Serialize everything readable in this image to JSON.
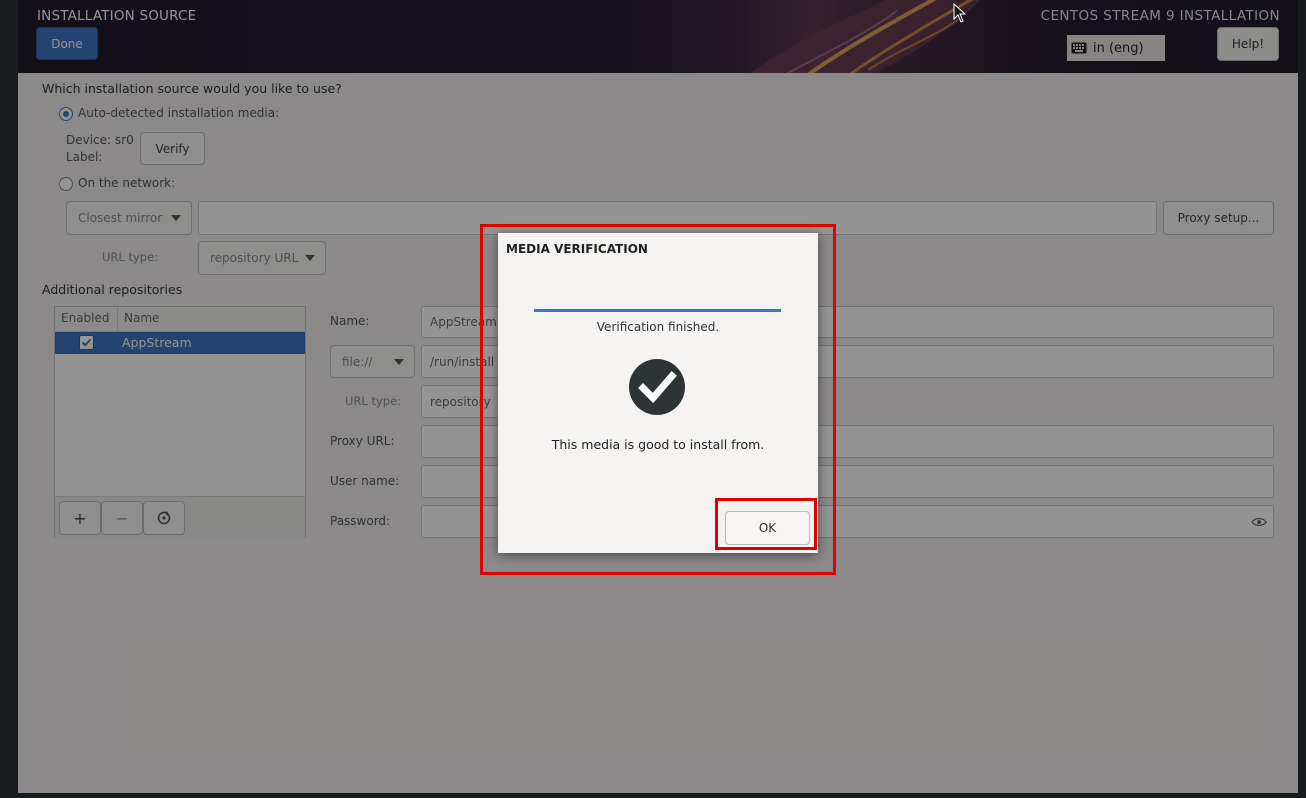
{
  "header": {
    "title": "INSTALLATION SOURCE",
    "done_label": "Done",
    "product": "CENTOS STREAM 9 INSTALLATION",
    "keyboard": "in (eng)",
    "help_label": "Help!"
  },
  "source": {
    "question": "Which installation source would you like to use?",
    "auto_label": "Auto-detected installation media:",
    "device": "Device: sr0",
    "label": "Label:",
    "verify_label": "Verify",
    "network_label": "On the network:",
    "mirror_value": "Closest mirror",
    "proxy_setup_label": "Proxy setup...",
    "url_type_label": "URL type:",
    "url_type_value": "repository URL"
  },
  "repos": {
    "heading": "Additional repositories",
    "col_enabled": "Enabled",
    "col_name": "Name",
    "rows": [
      {
        "name": "AppStream",
        "enabled": true
      }
    ],
    "name_label": "Name:",
    "name_value": "AppStream",
    "protocol_value": "file://",
    "path_value": "/run/install",
    "url_type_label": "URL type:",
    "url_type_value": "repository",
    "proxy_url_label": "Proxy URL:",
    "user_name_label": "User name:",
    "password_label": "Password:",
    "add_label": "+",
    "remove_label": "−"
  },
  "dialog": {
    "title": "MEDIA VERIFICATION",
    "progress": 1.0,
    "status": "Verification finished.",
    "message": "This media is good to install from.",
    "ok_label": "OK"
  },
  "colors": {
    "accent": "#3d76c2",
    "annotation": "#e00000",
    "selection": "#3d76c2"
  }
}
